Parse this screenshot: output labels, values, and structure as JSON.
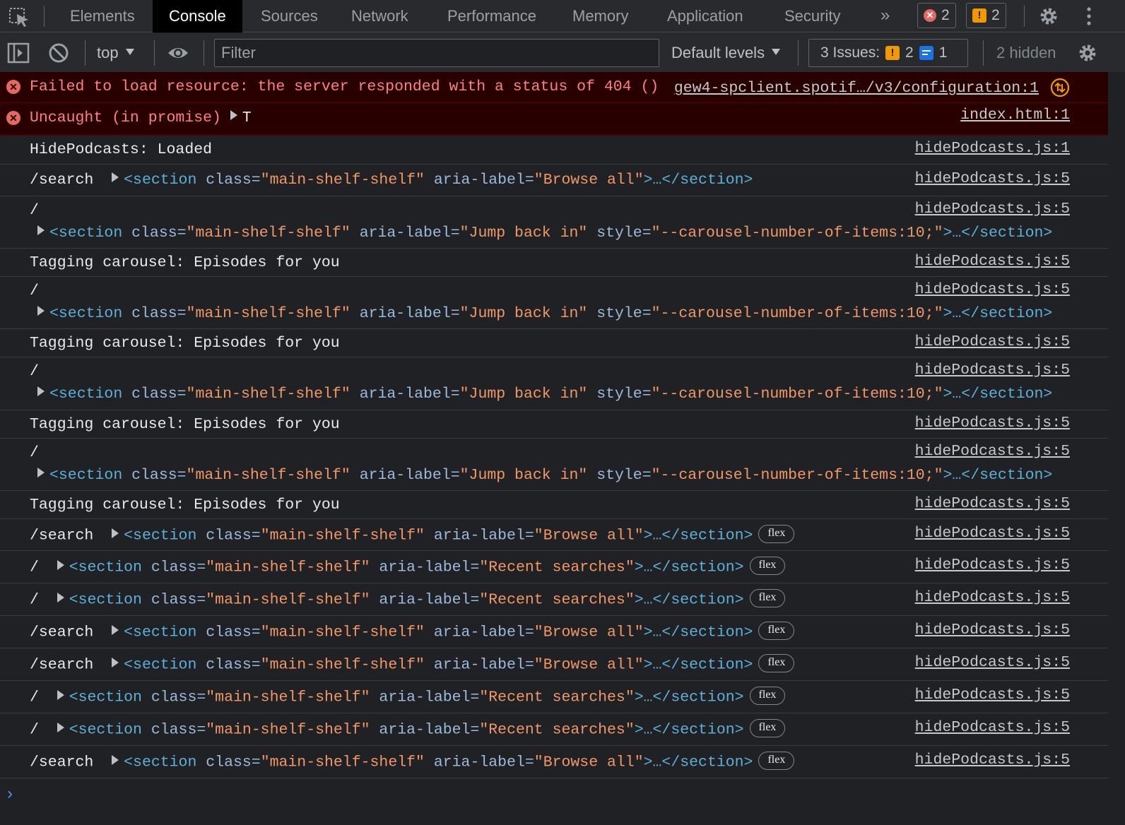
{
  "tabs": [
    "Elements",
    "Console",
    "Sources",
    "Network",
    "Performance",
    "Memory",
    "Application",
    "Security"
  ],
  "active_tab": "Console",
  "more_tabs": "»",
  "header_counts": {
    "errors": "2",
    "warnings": "2"
  },
  "toolbar": {
    "context": "top",
    "filter_placeholder": "Filter",
    "levels": "Default levels",
    "issues_label": "3 Issues:",
    "issues_warn": "2",
    "issues_info": "1",
    "hidden": "2 hidden"
  },
  "colors": {
    "error_bg": "#290000",
    "error_text": "#ff8080",
    "tag": "#5db0d7",
    "attr": "#9bbbdc",
    "value": "#f29766",
    "accent": "#4b91f7"
  },
  "messages": [
    {
      "type": "error",
      "text": "Failed to load resource: the server responded with a status of 404 ()",
      "source": "gew4-spclient.spotif…/v3/configuration:1"
    },
    {
      "type": "error",
      "text": "Uncaught (in promise)",
      "obj": "T",
      "source": "index.html:1"
    },
    {
      "type": "log",
      "text": "HidePodcasts: Loaded",
      "source": "hidePodcasts.js:1"
    },
    {
      "type": "section",
      "prefix": "/search",
      "label": "Browse all",
      "style": "",
      "badge": "",
      "source": "hidePodcasts.js:5"
    },
    {
      "type": "section2",
      "prefix": "/",
      "label": "Jump back in",
      "style": "--carousel-number-of-items:10;",
      "source": "hidePodcasts.js:5"
    },
    {
      "type": "log",
      "text": "Tagging carousel: Episodes for you",
      "source": "hidePodcasts.js:5"
    },
    {
      "type": "section2",
      "prefix": "/",
      "label": "Jump back in",
      "style": "--carousel-number-of-items:10;",
      "source": "hidePodcasts.js:5"
    },
    {
      "type": "log",
      "text": "Tagging carousel: Episodes for you",
      "source": "hidePodcasts.js:5"
    },
    {
      "type": "section2",
      "prefix": "/",
      "label": "Jump back in",
      "style": "--carousel-number-of-items:10;",
      "source": "hidePodcasts.js:5"
    },
    {
      "type": "log",
      "text": "Tagging carousel: Episodes for you",
      "source": "hidePodcasts.js:5"
    },
    {
      "type": "section2",
      "prefix": "/",
      "label": "Jump back in",
      "style": "--carousel-number-of-items:10;",
      "source": "hidePodcasts.js:5"
    },
    {
      "type": "log",
      "text": "Tagging carousel: Episodes for you",
      "source": "hidePodcasts.js:5"
    },
    {
      "type": "section",
      "prefix": "/search",
      "label": "Browse all",
      "badge": "flex",
      "source": "hidePodcasts.js:5"
    },
    {
      "type": "section",
      "prefix": "/",
      "label": "Recent searches",
      "badge": "flex",
      "source": "hidePodcasts.js:5"
    },
    {
      "type": "section",
      "prefix": "/",
      "label": "Recent searches",
      "badge": "flex",
      "source": "hidePodcasts.js:5"
    },
    {
      "type": "section",
      "prefix": "/search",
      "label": "Browse all",
      "badge": "flex",
      "source": "hidePodcasts.js:5"
    },
    {
      "type": "section",
      "prefix": "/search",
      "label": "Browse all",
      "badge": "flex",
      "source": "hidePodcasts.js:5"
    },
    {
      "type": "section",
      "prefix": "/",
      "label": "Recent searches",
      "badge": "flex",
      "source": "hidePodcasts.js:5"
    },
    {
      "type": "section",
      "prefix": "/",
      "label": "Recent searches",
      "badge": "flex",
      "source": "hidePodcasts.js:5"
    },
    {
      "type": "section",
      "prefix": "/search",
      "label": "Browse all",
      "badge": "flex",
      "source": "hidePodcasts.js:5"
    }
  ],
  "markup": {
    "open": "<section",
    "class_attr": "class=",
    "class_val": "\"main-shelf-shelf\"",
    "aria_attr": "aria-label=",
    "style_attr": "style=",
    "close": ">…</section>"
  },
  "prompt": "›"
}
